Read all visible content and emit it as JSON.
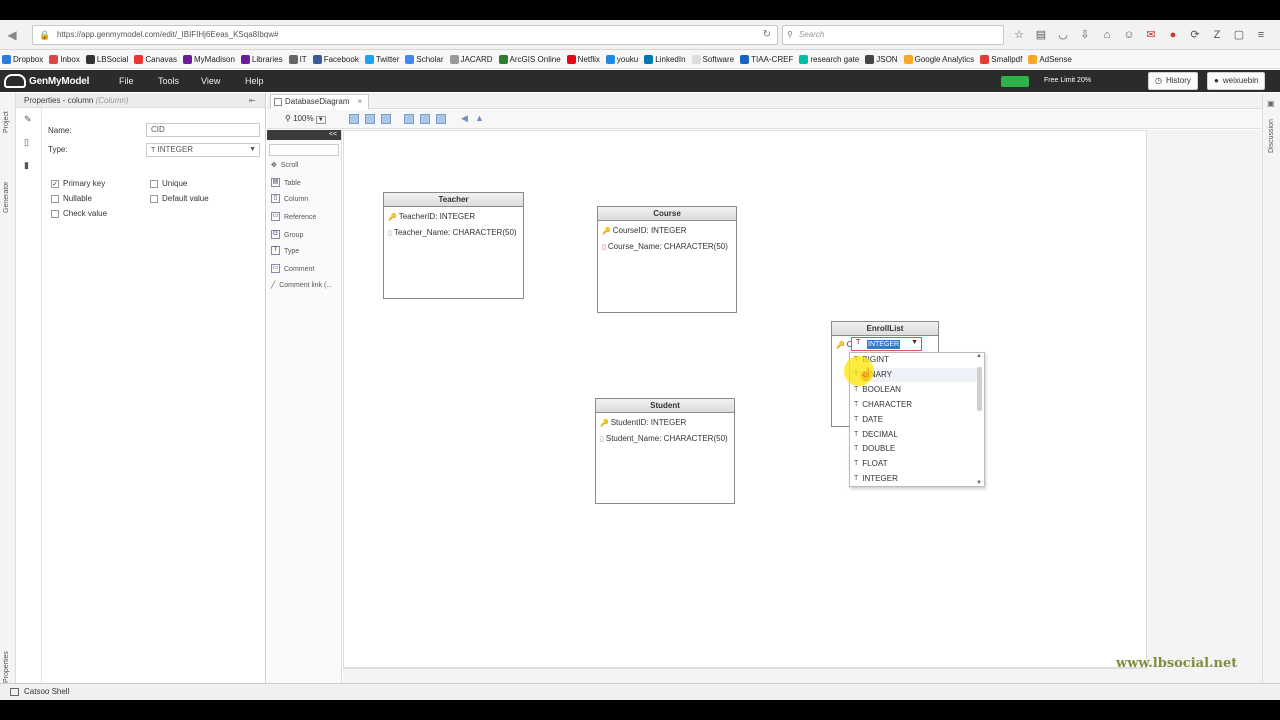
{
  "browser": {
    "url": "https://app.genmymodel.com/edit/_IBIFIHj6Eeas_KSqa8Ibqw#",
    "search_placeholder": "Search",
    "bookmarks": [
      "Dropbox",
      "Inbox",
      "LBSocial",
      "Canavas",
      "MyMadison",
      "Libraries",
      "IT",
      "Facebook",
      "Twitter",
      "Scholar",
      "JACARD",
      "ArcGIS Online",
      "Netflix",
      "youku",
      "LinkedIn",
      "Software",
      "TIAA-CREF",
      "research gate",
      "JSON",
      "Google Analytics",
      "Smallpdf",
      "AdSense"
    ]
  },
  "app": {
    "logo": "GenMyModel",
    "menu": [
      "File",
      "Tools",
      "View",
      "Help"
    ],
    "free_limit": "Free Limit 20%",
    "free_limit_fraction": 0.2,
    "history_label": "History",
    "user_label": "weixuebin"
  },
  "sidebar": {
    "project_tab": "Project",
    "generator_tab": "Generator",
    "properties_tab": "Properties"
  },
  "properties": {
    "title": "Properties - column",
    "subtitle": "(Column)",
    "name_label": "Name:",
    "name_value": "CID",
    "type_label": "Type:",
    "type_value": "INTEGER",
    "primary_key": "Primary key",
    "unique": "Unique",
    "nullable": "Nullable",
    "default_value": "Default value",
    "check_value": "Check value"
  },
  "editor": {
    "tab_label": "DatabaseDiagram",
    "zoom": "100%",
    "palette_collapse": "<<",
    "palette": [
      "Scroll",
      "Table",
      "Column",
      "Reference",
      "Group",
      "Type",
      "Comment",
      "Comment link (..."
    ]
  },
  "diagram": {
    "teacher": {
      "title": "Teacher",
      "cols": [
        "TeacherID: INTEGER",
        "Teacher_Name: CHARACTER(50)"
      ]
    },
    "course": {
      "title": "Course",
      "cols": [
        "CourseID: INTEGER",
        "Course_Name: CHARACTER(50)"
      ]
    },
    "student": {
      "title": "Student",
      "cols": [
        "StudentID: INTEGER",
        "Student_Name: CHARACTER(50)"
      ]
    },
    "enroll": {
      "title": "EnrollList",
      "col_prefix": "C",
      "edit_value": "INTEGER"
    }
  },
  "dropdown": {
    "options": [
      "BIGINT",
      "BINARY",
      "BOOLEAN",
      "CHARACTER",
      "DATE",
      "DECIMAL",
      "DOUBLE",
      "FLOAT",
      "INTEGER"
    ]
  },
  "right_panel": {
    "discussion": "Discussion"
  },
  "status": {
    "shell": "Catsoo Shell"
  },
  "watermark": "www.lbsocial.net"
}
